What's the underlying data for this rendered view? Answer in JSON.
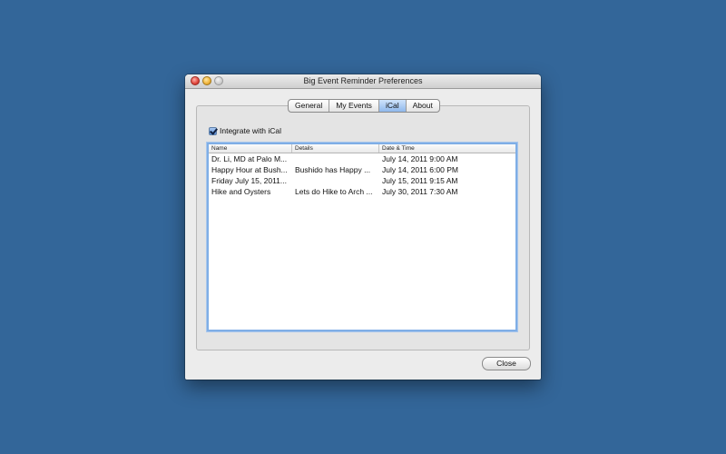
{
  "window": {
    "title": "Big Event Reminder Preferences"
  },
  "tabs": [
    {
      "label": "General"
    },
    {
      "label": "My Events"
    },
    {
      "label": "iCal",
      "active": true
    },
    {
      "label": "About"
    }
  ],
  "integrate": {
    "label": "Integrate with iCal",
    "checked": true
  },
  "table": {
    "headers": [
      "Name",
      "Details",
      "Date & Time"
    ],
    "rows": [
      [
        "Dr. Li, MD at Palo M...",
        "",
        "July 14, 2011 9:00 AM"
      ],
      [
        "Happy Hour at Bush...",
        "Bushido has Happy ...",
        "July 14, 2011 6:00 PM"
      ],
      [
        "Friday July 15, 2011...",
        "",
        "July 15, 2011 9:15 AM"
      ],
      [
        "Hike and Oysters",
        "Lets do Hike to Arch ...",
        "July 30, 2011 7:30 AM"
      ]
    ]
  },
  "buttons": {
    "close": "Close"
  },
  "colors": {
    "desktop": "#336699",
    "selection_blue": "#7faee6"
  }
}
